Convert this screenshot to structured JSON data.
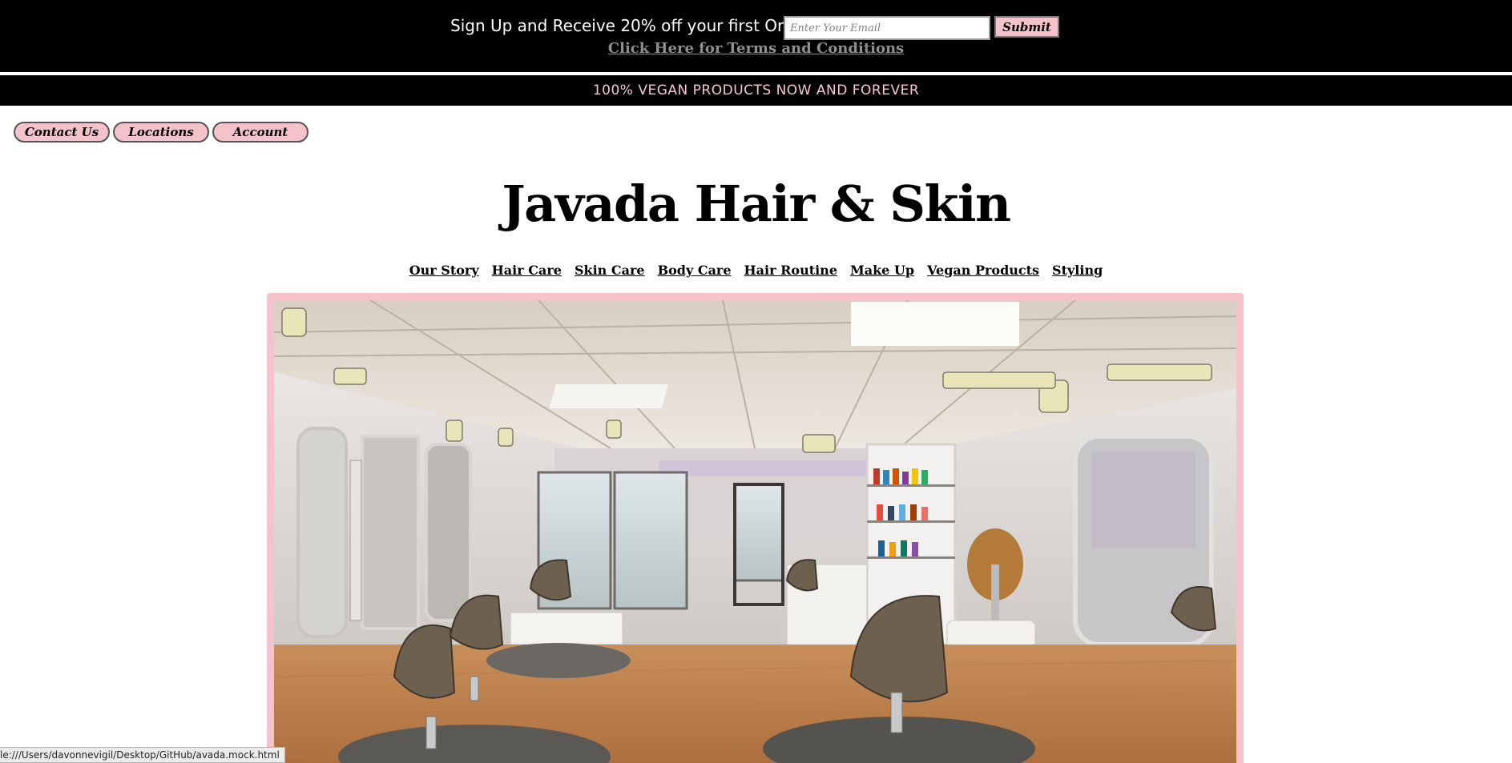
{
  "signup": {
    "text": "Sign Up and Receive 20% off your first Order",
    "email_placeholder": "Enter Your Email",
    "email_value": "",
    "submit_label": "Submit",
    "terms_link": "Click Here for Terms and Conditions"
  },
  "banner": {
    "vegan_text": "100% VEGAN PRODUCTS NOW AND FOREVER"
  },
  "util_nav": [
    {
      "label": "Contact Us"
    },
    {
      "label": "Locations"
    },
    {
      "label": "Account"
    }
  ],
  "site": {
    "title": "Javada Hair & Skin"
  },
  "main_nav": [
    {
      "label": "Our Story"
    },
    {
      "label": "Hair Care"
    },
    {
      "label": "Skin Care"
    },
    {
      "label": "Body Care"
    },
    {
      "label": "Hair Routine"
    },
    {
      "label": "Make Up"
    },
    {
      "label": "Vegan Products"
    },
    {
      "label": "Styling"
    }
  ],
  "status_bar": {
    "url": "le:///Users/davonnevigil/Desktop/GitHub/avada.mock.html"
  },
  "colors": {
    "black": "#000000",
    "pink": "#f4c2cb",
    "pink_text": "#f7c6cf",
    "gray_link": "#8f8f8f"
  }
}
